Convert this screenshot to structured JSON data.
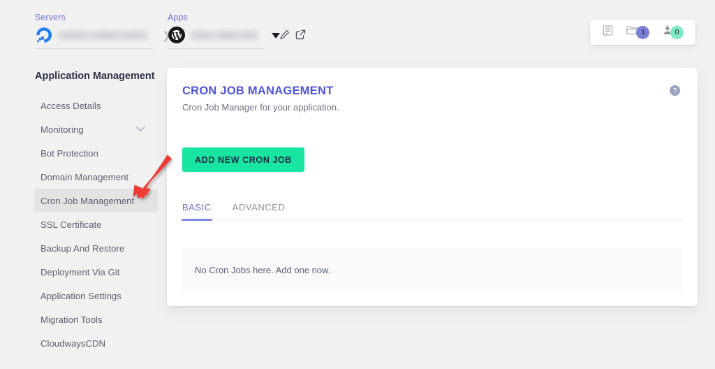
{
  "topbar": {
    "servers": {
      "label": "Servers",
      "logo_icon": "digitalocean-logo-icon",
      "name_value": ""
    },
    "apps": {
      "label": "Apps",
      "logo_icon": "wordpress-logo-icon",
      "name_value": ""
    },
    "separator_icon": "chevron-right-icon",
    "dropdown_icon": "caret-down-icon",
    "edit_icon": "pencil-icon",
    "launch_icon": "external-link-icon"
  },
  "counters": {
    "servers_icon": "server-list-icon",
    "projects_icon": "folder-icon",
    "projects_count": "1",
    "projects_badge_color": "#7b7fd4",
    "team_icon": "user-icon",
    "team_count": "0",
    "team_badge_color": "#7fe8c4"
  },
  "sidebar": {
    "title": "Application Management",
    "items": [
      {
        "label": "Access Details",
        "active": false,
        "chevron": false
      },
      {
        "label": "Monitoring",
        "active": false,
        "chevron": true
      },
      {
        "label": "Bot Protection",
        "active": false,
        "chevron": false
      },
      {
        "label": "Domain Management",
        "active": false,
        "chevron": false
      },
      {
        "label": "Cron Job Management",
        "active": true,
        "chevron": false
      },
      {
        "label": "SSL Certificate",
        "active": false,
        "chevron": false
      },
      {
        "label": "Backup And Restore",
        "active": false,
        "chevron": false
      },
      {
        "label": "Deployment Via Git",
        "active": false,
        "chevron": false
      },
      {
        "label": "Application Settings",
        "active": false,
        "chevron": false
      },
      {
        "label": "Migration Tools",
        "active": false,
        "chevron": false
      },
      {
        "label": "CloudwaysCDN",
        "active": false,
        "chevron": false
      }
    ]
  },
  "main": {
    "title": "CRON JOB MANAGEMENT",
    "subtitle": "Cron Job Manager for your application.",
    "help_icon": "question-mark-circle-icon",
    "add_button": "ADD NEW CRON JOB",
    "tabs": [
      {
        "label": "BASIC",
        "active": true
      },
      {
        "label": "ADVANCED",
        "active": false
      }
    ],
    "empty_message": "No Cron Jobs here. Add one now."
  },
  "annotation": {
    "arrow_icon": "red-arrow-icon",
    "color": "#ef3b36"
  },
  "colors": {
    "page_bg": "#f1f1f2",
    "card_bg": "#ffffff",
    "accent_purple": "#4d55d8",
    "accent_green": "#17e5a1",
    "active_item_bg": "#e3e3e3"
  }
}
